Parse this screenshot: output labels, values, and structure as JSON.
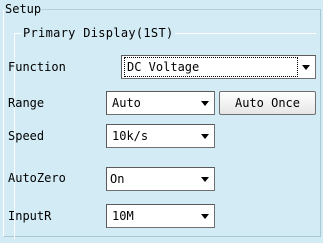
{
  "setup": {
    "legend": "Setup",
    "primary": {
      "legend": "Primary Display(1ST)",
      "function": {
        "label": "Function",
        "value": "DC Voltage"
      },
      "range": {
        "label": "Range",
        "value": "Auto",
        "button": "Auto Once"
      },
      "speed": {
        "label": "Speed",
        "value": "10k/s"
      },
      "autozero": {
        "label": "AutoZero",
        "value": "On"
      },
      "inputr": {
        "label": "InputR",
        "value": "10M"
      }
    }
  }
}
